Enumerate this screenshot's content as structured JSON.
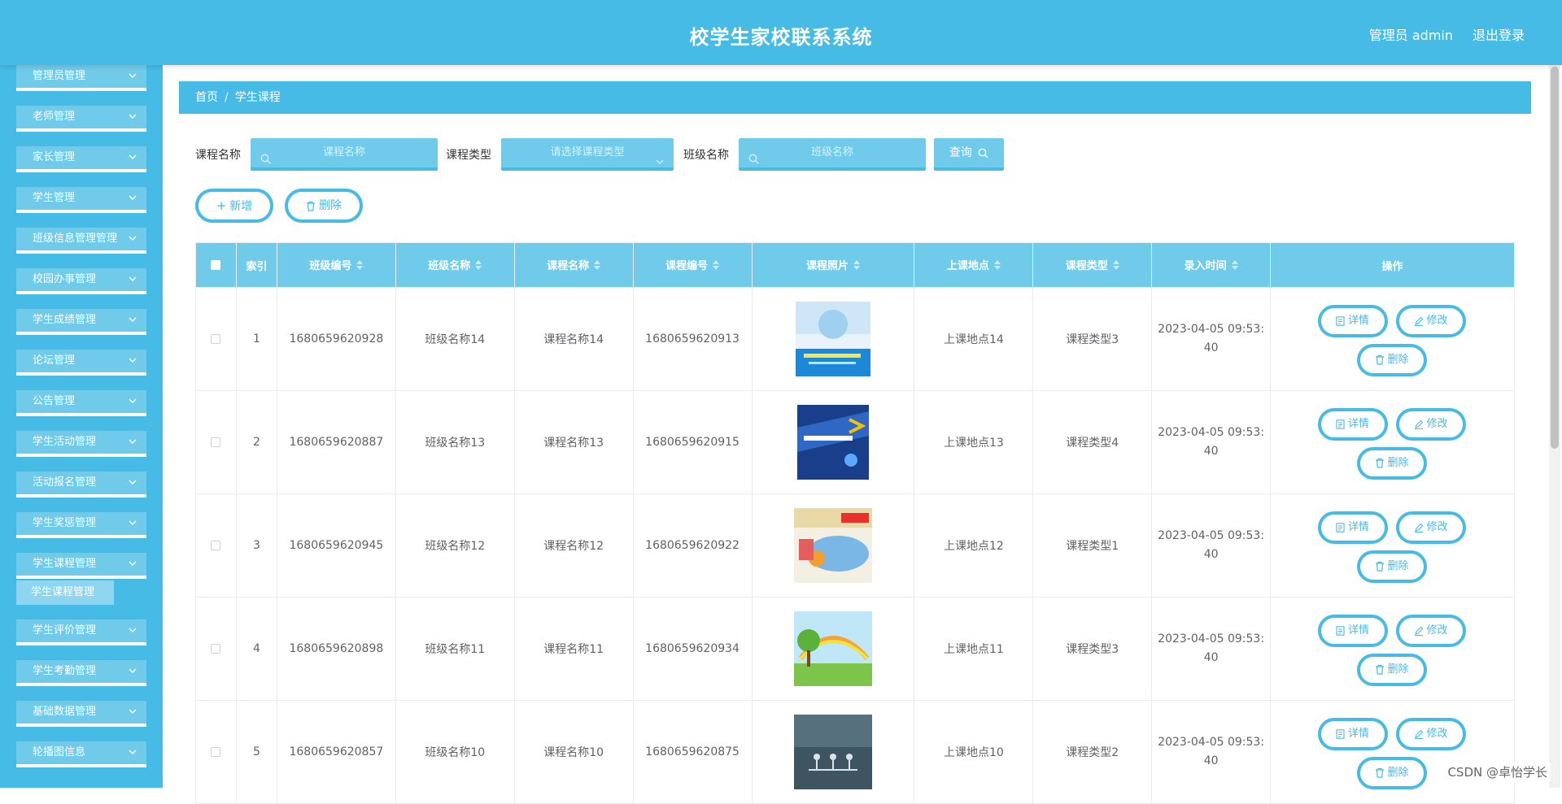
{
  "header": {
    "title": "校学生家校联系系统",
    "user": "管理员 admin",
    "logout": "退出登录"
  },
  "sidebar": {
    "items": [
      {
        "label": "管理员管理"
      },
      {
        "label": "老师管理"
      },
      {
        "label": "家长管理"
      },
      {
        "label": "学生管理"
      },
      {
        "label": "班级信息管理管理"
      },
      {
        "label": "校园办事管理"
      },
      {
        "label": "学生成绩管理"
      },
      {
        "label": "论坛管理"
      },
      {
        "label": "公告管理"
      },
      {
        "label": "学生活动管理"
      },
      {
        "label": "活动报名管理"
      },
      {
        "label": "学生奖惩管理"
      },
      {
        "label": "学生课程管理"
      },
      {
        "label": "学生评价管理"
      },
      {
        "label": "学生考勤管理"
      },
      {
        "label": "基础数据管理"
      },
      {
        "label": "轮播图信息"
      }
    ],
    "active_sub": "学生课程管理"
  },
  "breadcrumb": {
    "home": "首页",
    "sep": "/",
    "current": "学生课程"
  },
  "search": {
    "course_name_label": "课程名称",
    "course_name_placeholder": "课程名称",
    "course_type_label": "课程类型",
    "course_type_placeholder": "请选择课程类型",
    "class_name_label": "班级名称",
    "class_name_placeholder": "班级名称",
    "query_label": "查询"
  },
  "actions": {
    "add": "新增",
    "delete": "删除"
  },
  "table": {
    "headers": [
      "索引",
      "班级编号",
      "班级名称",
      "课程名称",
      "课程编号",
      "课程照片",
      "上课地点",
      "课程类型",
      "录入时间",
      "操作"
    ],
    "ops": {
      "detail": "详情",
      "edit": "修改",
      "delete": "删除"
    },
    "rows": [
      {
        "index": "1",
        "class_no": "1680659620928",
        "class_name": "班级名称14",
        "course_name": "课程名称14",
        "course_no": "1680659620913",
        "location": "上课地点14",
        "type": "课程类型3",
        "time1": "2023-04-05 09:53:",
        "time2": "40"
      },
      {
        "index": "2",
        "class_no": "1680659620887",
        "class_name": "班级名称13",
        "course_name": "课程名称13",
        "course_no": "1680659620915",
        "location": "上课地点13",
        "type": "课程类型4",
        "time1": "2023-04-05 09:53:",
        "time2": "40"
      },
      {
        "index": "3",
        "class_no": "1680659620945",
        "class_name": "班级名称12",
        "course_name": "课程名称12",
        "course_no": "1680659620922",
        "location": "上课地点12",
        "type": "课程类型1",
        "time1": "2023-04-05 09:53:",
        "time2": "40"
      },
      {
        "index": "4",
        "class_no": "1680659620898",
        "class_name": "班级名称11",
        "course_name": "课程名称11",
        "course_no": "1680659620934",
        "location": "上课地点11",
        "type": "课程类型3",
        "time1": "2023-04-05 09:53:",
        "time2": "40"
      },
      {
        "index": "5",
        "class_no": "1680659620857",
        "class_name": "班级名称10",
        "course_name": "课程名称10",
        "course_no": "1680659620875",
        "location": "上课地点10",
        "type": "课程类型2",
        "time1": "2023-04-05 09:53:",
        "time2": "40"
      }
    ]
  },
  "watermark": "CSDN @卓怡学长",
  "colors": {
    "primary": "#45bbe6",
    "light": "#6fcbe9",
    "lighter": "#8ed6ef"
  }
}
